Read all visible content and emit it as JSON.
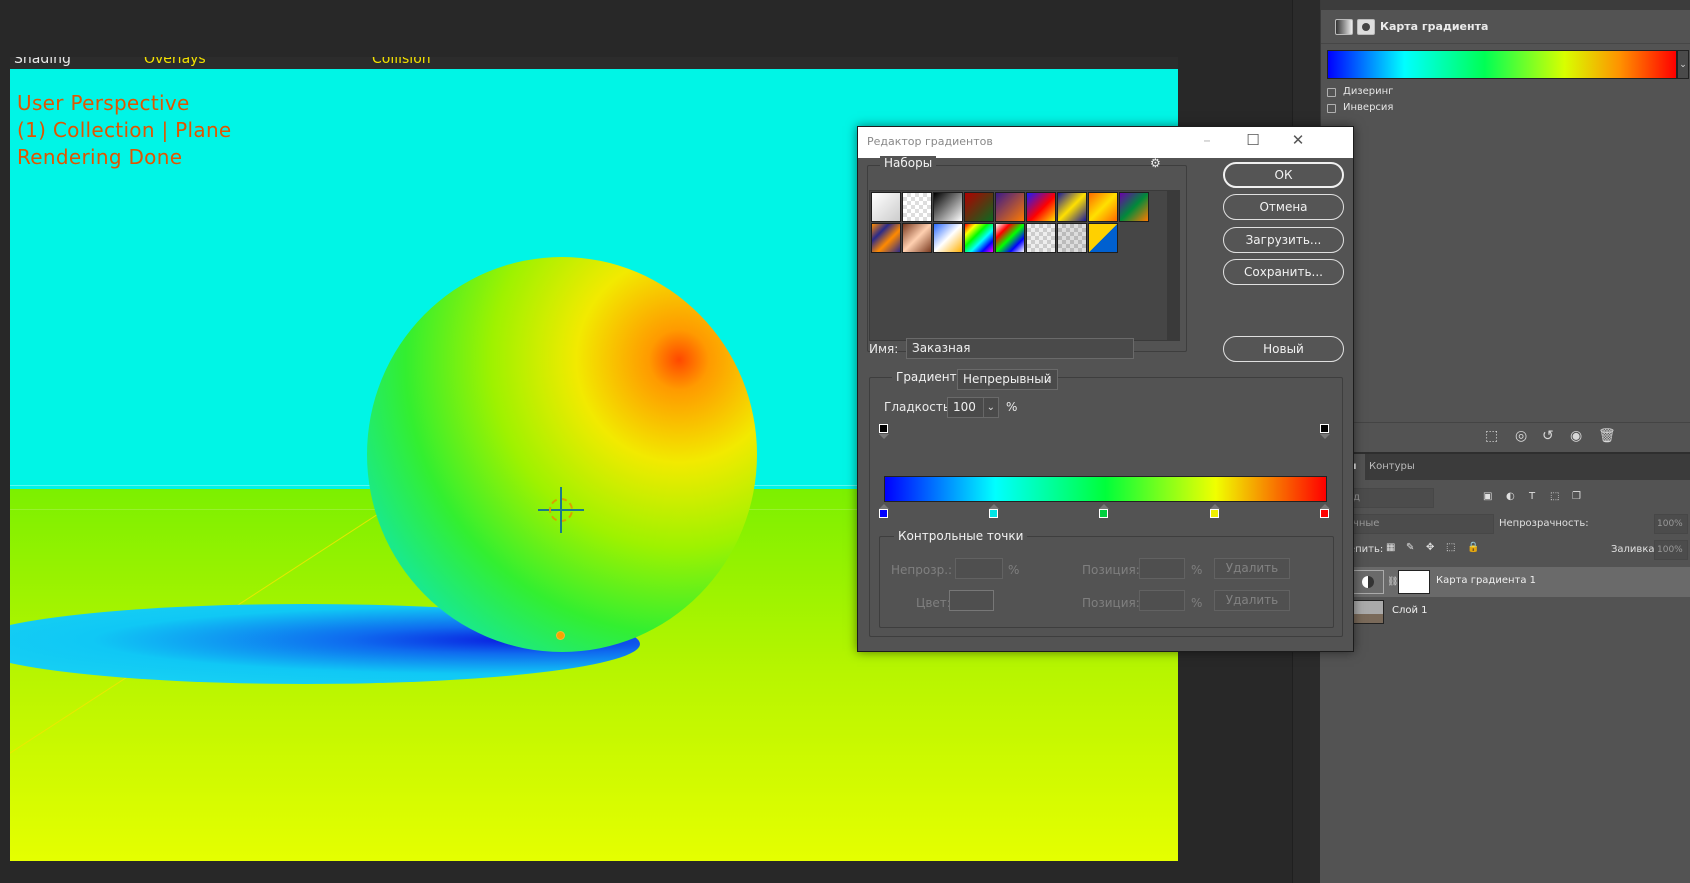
{
  "viewport": {
    "overlay_lines": [
      "User Perspective",
      "(1) Collection | Plane",
      "Rendering Done"
    ],
    "header_fragments": [
      "Shading",
      "Overlays",
      "Collision"
    ]
  },
  "properties": {
    "title": "Карта градиента",
    "options": [
      {
        "label": "Дизеринг",
        "checked": false
      },
      {
        "label": "Инверсия",
        "checked": false
      }
    ]
  },
  "layers": {
    "tabs": [
      "Слои",
      "Контуры"
    ],
    "search_placeholder": "Вид",
    "blend_mode": "Обычные",
    "opacity_label": "Непрозрачность:",
    "opacity_value": "100%",
    "lock_label": "Закрепить:",
    "fill_label": "Заливка:",
    "fill_value": "100%",
    "items": [
      {
        "name": "Карта градиента 1",
        "selected": true,
        "icon": "adjustment-layer-icon"
      },
      {
        "name": "Слой 1",
        "selected": false,
        "icon": "image-thumbnail"
      }
    ]
  },
  "dialog": {
    "title": "Редактор градиентов",
    "presets_label": "Наборы",
    "buttons": {
      "ok": "ОК",
      "cancel": "Отмена",
      "load": "Загрузить...",
      "save": "Сохранить...",
      "new": "Новый"
    },
    "name_label": "Имя:",
    "name_value": "Заказная",
    "gradient_type_label": "Градиент:",
    "gradient_type_value": "Непрерывный",
    "smoothness_label": "Гладкость:",
    "smoothness_value": "100",
    "percent": "%",
    "stops_label": "Контрольные точки",
    "opacity_label": "Непрозр.:",
    "position_label": "Позиция:",
    "color_label": "Цвет:",
    "delete_label": "Удалить",
    "gradient_stops": [
      "#0000ff",
      "#00e5e5",
      "#00d040",
      "#f0f000",
      "#ff0000"
    ],
    "opacity_stops": [
      "#000000",
      "#000000"
    ]
  }
}
